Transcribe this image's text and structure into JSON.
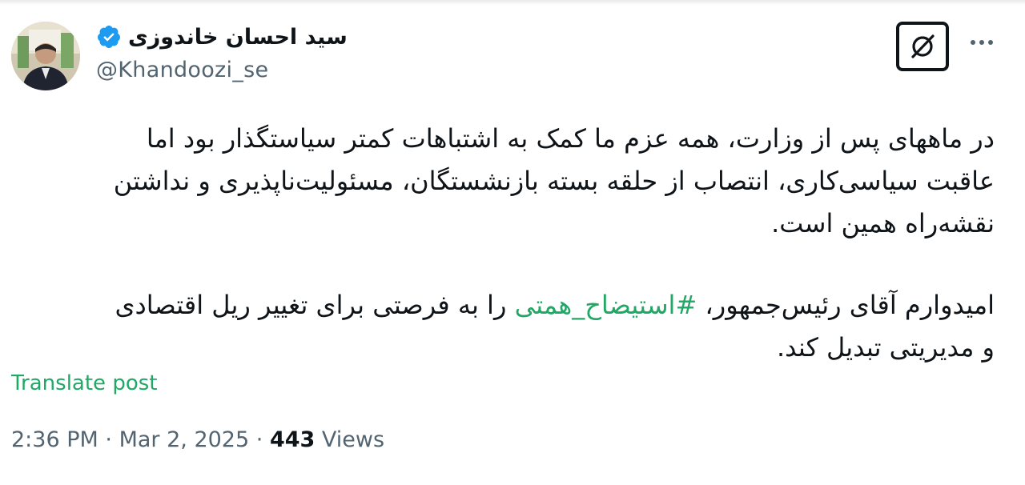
{
  "post": {
    "author": {
      "display_name": "سید احسان خاندوزی",
      "handle": "@Khandoozi_se",
      "verified": true,
      "verified_color": "#1d9bf0"
    },
    "text": {
      "paragraph_1_lines": [
        "در ماههای پس از وزارت، همه عزم ما کمک به اشتباهات کمتر سیاستگذار بود اما",
        "عاقبت سیاسی‌کاری، انتصاب از حلقه بسته بازنشستگان، مسئولیت‌ناپذیری و نداشتن",
        "نقشه‌راه همین است."
      ],
      "paragraph_2_line_1_before": "امیدوارم آقای رئیس‌جمهور، ",
      "hashtag": "#استیضاح_همتی",
      "paragraph_2_line_1_after": " را به فرصتی برای تغییر ریل اقتصادی",
      "paragraph_2_line_2": "و مدیریتی تبدیل کند."
    },
    "translate_label": "Translate post",
    "time": "2:36 PM",
    "separator": "·",
    "date": "Mar 2, 2025",
    "views_count": "443",
    "views_label": "Views",
    "accent_color": "#22a866"
  }
}
